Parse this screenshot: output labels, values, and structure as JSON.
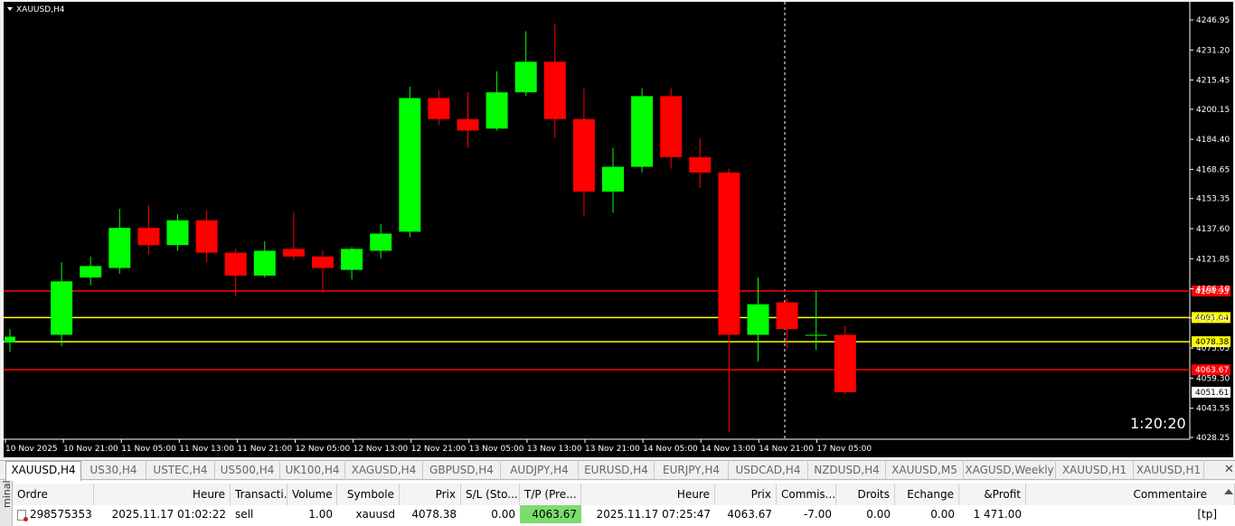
{
  "chart": {
    "title": "XAUUSD,H4",
    "timer": "1:20:20",
    "price_min": 4028.25,
    "price_max": 4246.95,
    "y_ticks": [
      "4246.95",
      "4231.20",
      "4215.45",
      "4200.15",
      "4184.40",
      "4168.65",
      "4153.35",
      "4137.60",
      "4121.85",
      "4106.10",
      "4090.80",
      "4075.05",
      "4059.30",
      "4043.55",
      "4028.25"
    ],
    "x_labels": [
      "10 Nov 2025",
      "10 Nov 21:00",
      "11 Nov 05:00",
      "11 Nov 13:00",
      "11 Nov 21:00",
      "12 Nov 05:00",
      "12 Nov 13:00",
      "12 Nov 21:00",
      "13 Nov 05:00",
      "13 Nov 13:00",
      "13 Nov 21:00",
      "14 Nov 05:00",
      "14 Nov 13:00",
      "14 Nov 21:00",
      "17 Nov 05:00"
    ],
    "level_lines": [
      {
        "price": 4104.93,
        "label": "4104.93",
        "color": "#ff0000",
        "label_bg": "#ff0000",
        "label_fg": "#ffffff"
      },
      {
        "price": 4091.04,
        "label": "4091.04",
        "color": "#ffff00",
        "label_bg": "#ffff00",
        "label_fg": "#000000"
      },
      {
        "price": 4078.38,
        "label": "4078.38",
        "color": "#ffff00",
        "label_bg": "#ffff00",
        "label_fg": "#000000"
      },
      {
        "price": 4063.67,
        "label": "4063.67",
        "color": "#ff0000",
        "label_bg": "#ff0000",
        "label_fg": "#ffffff"
      }
    ],
    "current_price_label": "4051.61",
    "colors": {
      "bull": "#00ff00",
      "bear": "#ff0000",
      "background": "#000000",
      "axis_text": "#ffffff"
    }
  },
  "chart_data": {
    "type": "candlestick",
    "title": "XAUUSD,H4",
    "candles": [
      {
        "o": 4078,
        "h": 4085,
        "l": 4073,
        "c": 4081
      },
      {
        "o": 4082,
        "h": 4120,
        "l": 4076,
        "c": 4110
      },
      {
        "o": 4112,
        "h": 4123,
        "l": 4108,
        "c": 4118
      },
      {
        "o": 4117,
        "h": 4148,
        "l": 4114,
        "c": 4138
      },
      {
        "o": 4138,
        "h": 4150,
        "l": 4124,
        "c": 4129
      },
      {
        "o": 4129,
        "h": 4145,
        "l": 4126,
        "c": 4142
      },
      {
        "o": 4142,
        "h": 4147,
        "l": 4120,
        "c": 4125
      },
      {
        "o": 4125,
        "h": 4127,
        "l": 4102,
        "c": 4113
      },
      {
        "o": 4113,
        "h": 4131,
        "l": 4112,
        "c": 4126
      },
      {
        "o": 4127,
        "h": 4146,
        "l": 4121,
        "c": 4123
      },
      {
        "o": 4123,
        "h": 4126,
        "l": 4104,
        "c": 4117
      },
      {
        "o": 4116,
        "h": 4128,
        "l": 4111,
        "c": 4127
      },
      {
        "o": 4126,
        "h": 4140,
        "l": 4122,
        "c": 4135
      },
      {
        "o": 4136,
        "h": 4212,
        "l": 4133,
        "c": 4206
      },
      {
        "o": 4206,
        "h": 4210,
        "l": 4192,
        "c": 4195
      },
      {
        "o": 4195,
        "h": 4209,
        "l": 4180,
        "c": 4189
      },
      {
        "o": 4190,
        "h": 4220,
        "l": 4189,
        "c": 4209
      },
      {
        "o": 4209,
        "h": 4241,
        "l": 4207,
        "c": 4225
      },
      {
        "o": 4225,
        "h": 4245,
        "l": 4185,
        "c": 4195
      },
      {
        "o": 4195,
        "h": 4211,
        "l": 4144,
        "c": 4157
      },
      {
        "o": 4157,
        "h": 4180,
        "l": 4146,
        "c": 4170
      },
      {
        "o": 4170,
        "h": 4211,
        "l": 4167,
        "c": 4207
      },
      {
        "o": 4207,
        "h": 4211,
        "l": 4169,
        "c": 4175
      },
      {
        "o": 4175,
        "h": 4185,
        "l": 4159,
        "c": 4167
      },
      {
        "o": 4167,
        "h": 4169,
        "l": 4031,
        "c": 4082
      },
      {
        "o": 4082,
        "h": 4112,
        "l": 4068,
        "c": 4098
      },
      {
        "o": 4099,
        "h": 4101,
        "l": 4075,
        "c": 4085
      },
      {
        "o": 4082,
        "h": 4105,
        "l": 4074,
        "c": 4082
      },
      {
        "o": 4082,
        "h": 4087,
        "l": 4051,
        "c": 4052
      }
    ]
  },
  "tabs": [
    {
      "label": "XAUUSD,H4",
      "active": true
    },
    {
      "label": "US30,H4"
    },
    {
      "label": "USTEC,H4"
    },
    {
      "label": "US500,H4"
    },
    {
      "label": "UK100,H4"
    },
    {
      "label": "XAGUSD,H4"
    },
    {
      "label": "GBPUSD,H4"
    },
    {
      "label": "AUDJPY,H4"
    },
    {
      "label": "EURUSD,H4"
    },
    {
      "label": "EURJPY,H4"
    },
    {
      "label": "USDCAD,H4"
    },
    {
      "label": "NZDUSD,H4"
    },
    {
      "label": "XAUUSD,M5"
    },
    {
      "label": "XAGUSD,Weekly"
    },
    {
      "label": "XAUUSD,H1"
    },
    {
      "label": "XAUUSD,H1"
    }
  ],
  "terminal": {
    "side_label": "minal",
    "columns": [
      "Ordre",
      "Heure",
      "Transacti...",
      "Volume",
      "Symbole",
      "Prix",
      "S/L (Sto...",
      "T/P (Pre...",
      "Heure",
      "Prix",
      "Commis...",
      "Droits",
      "Echange",
      "&Profit",
      "Commentaire"
    ],
    "row": [
      "298575353",
      "2025.11.17 01:02:22",
      "sell",
      "1.00",
      "xauusd",
      "4078.38",
      "0.00",
      "4063.67",
      "2025.11.17 07:25:47",
      "4063.67",
      "-7.00",
      "0.00",
      "0.00",
      "1 471.00",
      "[tp]"
    ]
  }
}
